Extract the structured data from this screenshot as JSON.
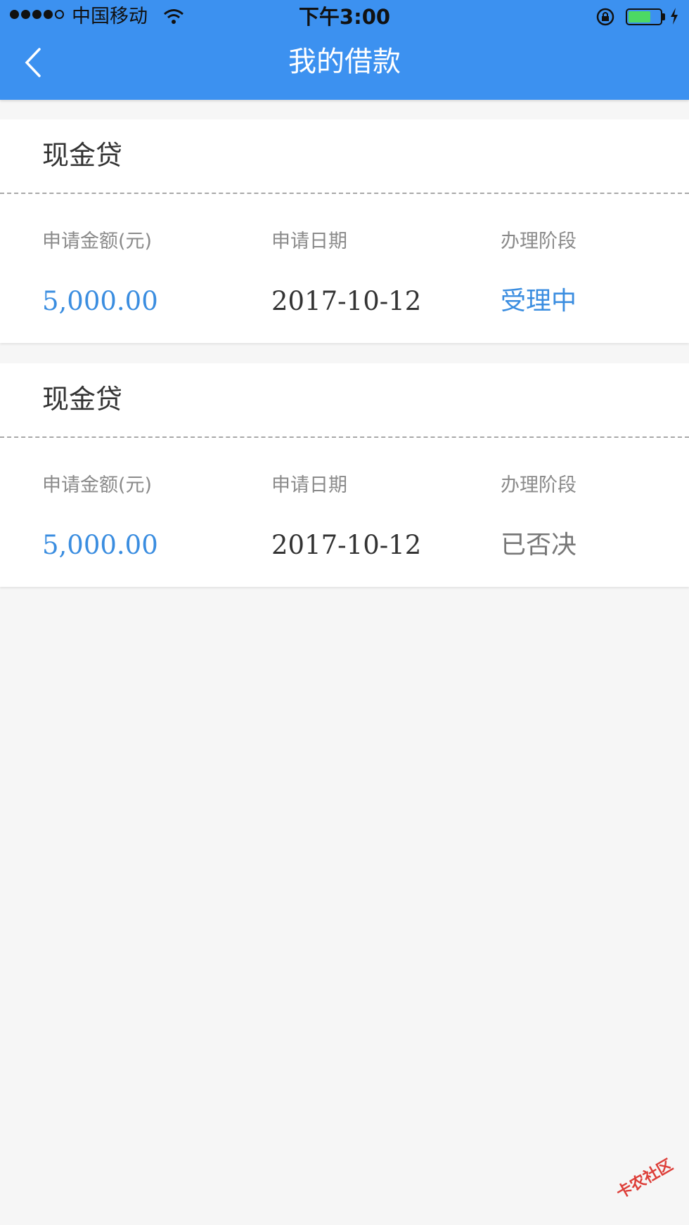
{
  "status_bar": {
    "carrier": "中国移动",
    "time": "下午3:00"
  },
  "nav": {
    "title": "我的借款"
  },
  "loans": [
    {
      "product": "现金贷",
      "amount_label": "申请金额(元)",
      "date_label": "申请日期",
      "stage_label": "办理阶段",
      "amount": "5,000.00",
      "date": "2017-10-12",
      "stage": "受理中"
    },
    {
      "product": "现金贷",
      "amount_label": "申请金额(元)",
      "date_label": "申请日期",
      "stage_label": "办理阶段",
      "amount": "5,000.00",
      "date": "2017-10-12",
      "stage": "已否决"
    }
  ],
  "watermark": "卡农社区",
  "colors": {
    "header": "#3c91f0",
    "accent": "#3a8de0",
    "background": "#f6f6f6"
  }
}
